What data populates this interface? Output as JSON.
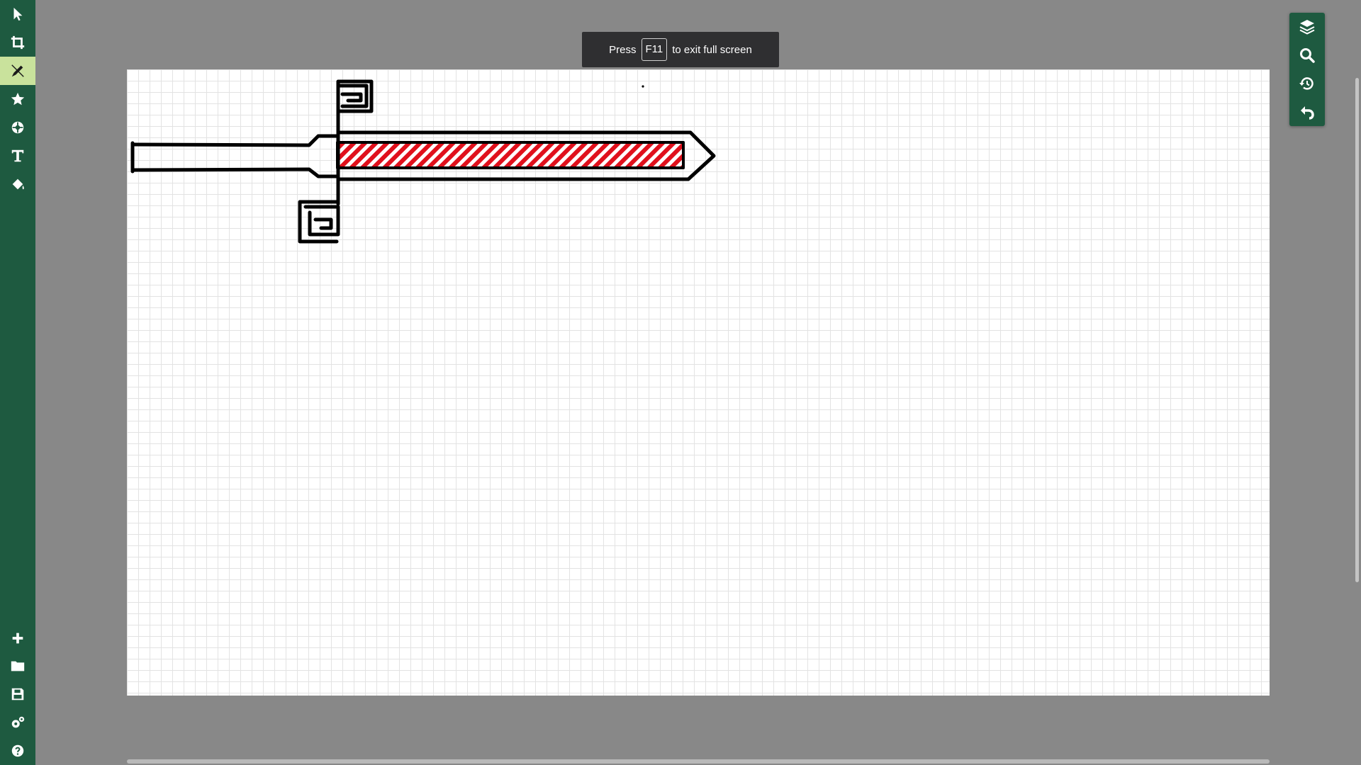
{
  "toolbar_left": {
    "tools": [
      {
        "name": "select-tool",
        "icon": "cursor-arrow-icon"
      },
      {
        "name": "crop-tool",
        "icon": "crop-icon"
      },
      {
        "name": "pen-tool",
        "icon": "pen-icon",
        "active": true
      },
      {
        "name": "stamp-tool",
        "icon": "star-icon"
      },
      {
        "name": "brush-tool",
        "icon": "brush-ball-icon"
      },
      {
        "name": "text-tool",
        "icon": "text-t-icon",
        "label": "T"
      },
      {
        "name": "fill-tool",
        "icon": "paint-bucket-icon"
      }
    ],
    "bottom_tools": [
      {
        "name": "new-button",
        "icon": "plus-icon"
      },
      {
        "name": "open-button",
        "icon": "folder-icon"
      },
      {
        "name": "save-button",
        "icon": "floppy-disk-icon"
      },
      {
        "name": "settings-button",
        "icon": "gears-icon"
      },
      {
        "name": "help-button",
        "icon": "question-circle-icon"
      }
    ]
  },
  "toolbar_right": {
    "tools": [
      {
        "name": "layers-button",
        "icon": "layers-icon"
      },
      {
        "name": "zoom-button",
        "icon": "magnifier-icon"
      },
      {
        "name": "history-button",
        "icon": "history-icon"
      },
      {
        "name": "undo-button",
        "icon": "undo-icon"
      }
    ]
  },
  "fullscreen_notice": {
    "prefix": "Press",
    "key": "F11",
    "suffix": "to exit full screen"
  },
  "colors": {
    "toolbar": "#1e5a40",
    "active_tool": "#c9e29c",
    "workspace": "#888888",
    "canvas": "#ffffff",
    "grid": "#e3e3e3",
    "stroke": "#000000",
    "hatch": "#e0101c"
  }
}
